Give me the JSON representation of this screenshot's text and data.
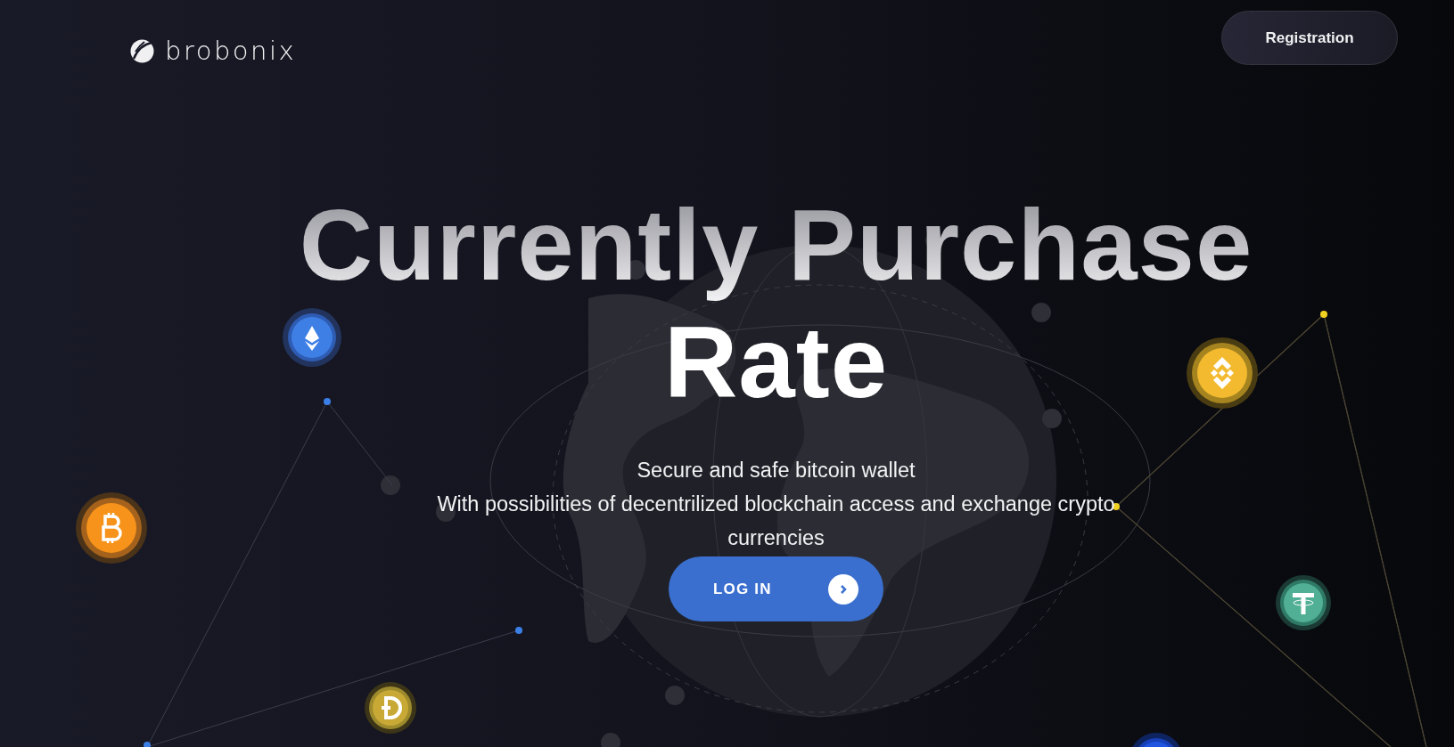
{
  "header": {
    "brand": "brobonix",
    "button": "Registration"
  },
  "hero": {
    "title_lines": [
      "Currently Purchase",
      "Rate"
    ],
    "subtitle_lines": [
      "Secure and safe bitcoin wallet",
      "With possibilities of decentrilized blockchain access and exchange crypto currencies"
    ],
    "button": "LOG IN"
  }
}
